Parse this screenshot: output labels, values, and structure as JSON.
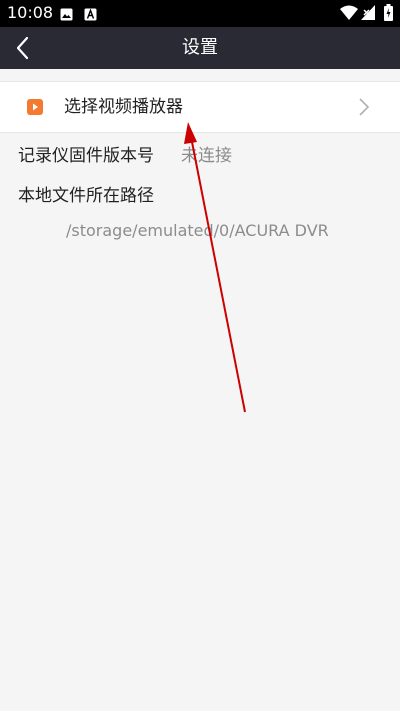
{
  "status_bar": {
    "time": "10:08",
    "left_icons": [
      "image-icon",
      "a-icon"
    ],
    "right_icons": [
      "wifi-icon",
      "signal-icon",
      "battery-icon"
    ]
  },
  "header": {
    "title": "设置",
    "back_icon": "chevron-left-icon",
    "background": "#2a2a35"
  },
  "settings": {
    "video_player": {
      "label": "选择视频播放器",
      "icon": "play-icon",
      "icon_color": "#f47a2f"
    },
    "firmware": {
      "label": "记录仪固件版本号",
      "value": "未连接"
    },
    "local_path": {
      "label": "本地文件所在路径",
      "value": "/storage/emulated/0/ACURA DVR"
    }
  },
  "annotation_color": "#cc0000"
}
